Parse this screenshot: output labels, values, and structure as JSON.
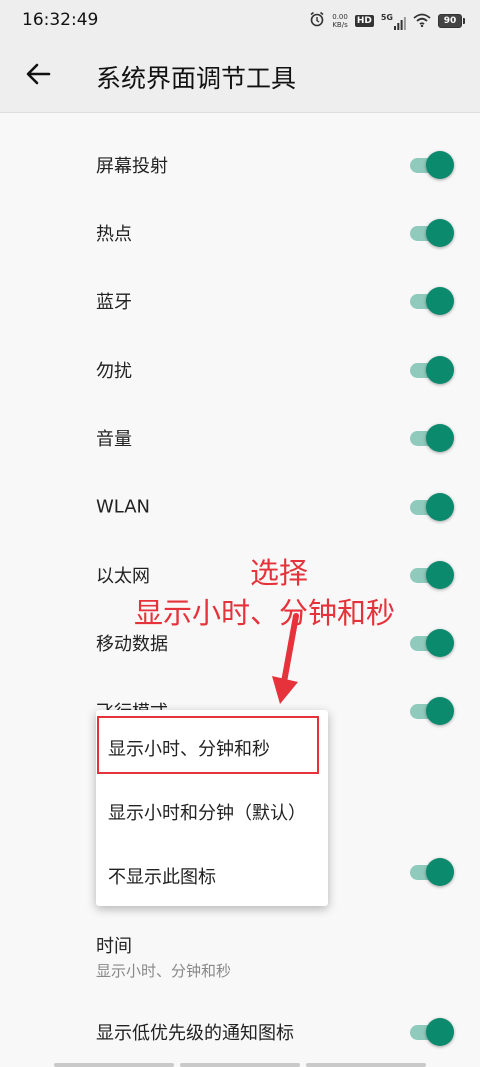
{
  "status_bar": {
    "time": "16:32:49",
    "net_speed_value": "0.00",
    "net_speed_unit": "KB/s",
    "hd_label": "HD",
    "network_label": "5G",
    "battery": "90",
    "icons": [
      "alarm-icon",
      "hd-icon",
      "signal-5g-icon",
      "wifi-icon",
      "battery-icon"
    ]
  },
  "app_bar": {
    "title": "系统界面调节工具",
    "back_icon": "back-arrow-icon"
  },
  "settings": [
    {
      "label": "屏幕投射",
      "enabled": true
    },
    {
      "label": "热点",
      "enabled": true
    },
    {
      "label": "蓝牙",
      "enabled": true
    },
    {
      "label": "勿扰",
      "enabled": true
    },
    {
      "label": "音量",
      "enabled": true
    },
    {
      "label": "WLAN",
      "enabled": true
    },
    {
      "label": "以太网",
      "enabled": true
    },
    {
      "label": "移动数据",
      "enabled": true
    },
    {
      "label": "飞行模式",
      "enabled": true
    },
    {
      "label": "",
      "enabled": true
    },
    {
      "label": "时间",
      "summary": "显示小时、分钟和秒"
    },
    {
      "label": "显示低优先级的通知图标",
      "enabled": true
    }
  ],
  "time_dropdown": {
    "options": [
      "显示小时、分钟和秒",
      "显示小时和分钟（默认）",
      "不显示此图标"
    ],
    "highlighted_index": 0
  },
  "annotation": {
    "line1": "选择",
    "line2": "显示小时、分钟和秒",
    "color": "#e5323b"
  },
  "colors": {
    "switch_thumb": "#0b8a6e",
    "switch_track": "#8fcabd",
    "background": "#f8f8f8",
    "app_bar": "#eeeeee"
  }
}
